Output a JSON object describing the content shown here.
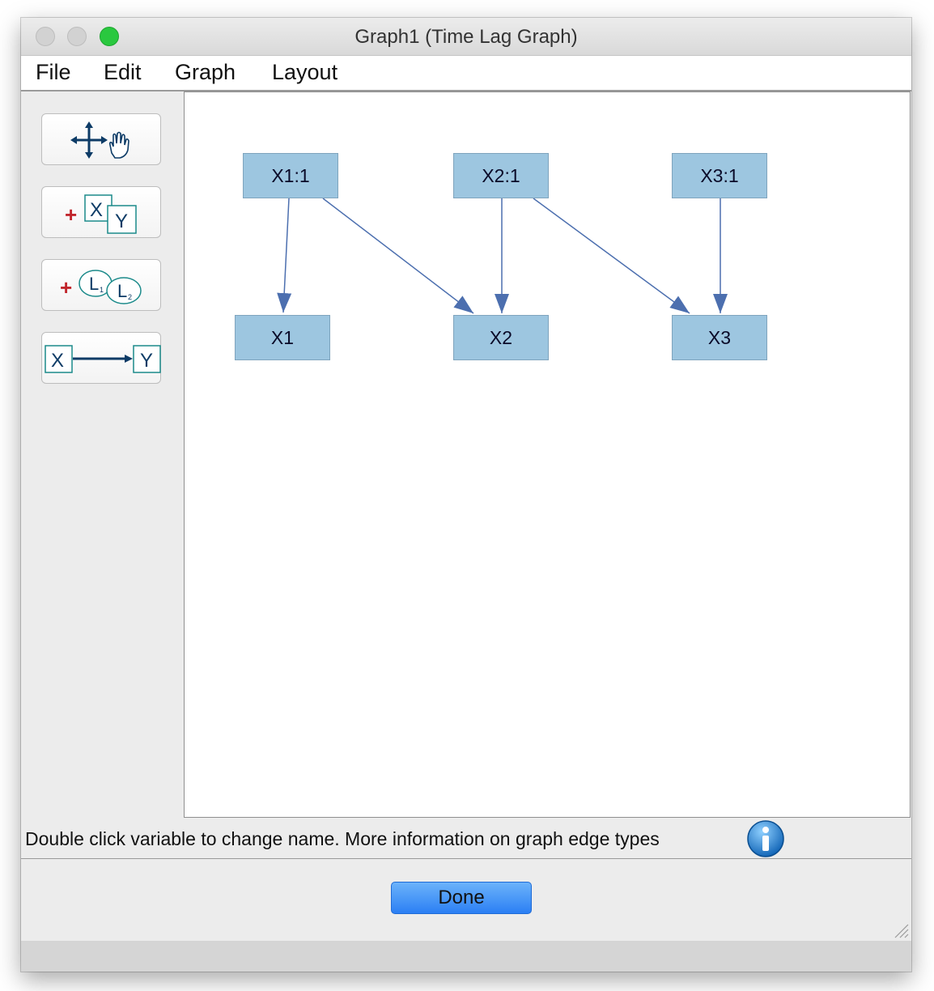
{
  "window": {
    "title": "Graph1 (Time Lag Graph)"
  },
  "menu": {
    "items": [
      "File",
      "Edit",
      "Graph",
      "Layout"
    ]
  },
  "toolbar": {
    "tools": [
      {
        "name": "move",
        "icon": "move-hand-icon"
      },
      {
        "name": "add-variable",
        "icon": "add-measured-variable-icon",
        "glyphs": [
          "+",
          "X",
          "Y"
        ]
      },
      {
        "name": "add-latent",
        "icon": "add-latent-variable-icon",
        "glyphs": [
          "+",
          "L",
          "L"
        ]
      },
      {
        "name": "add-edge",
        "icon": "directed-edge-icon",
        "glyphs": [
          "X",
          "Y"
        ]
      }
    ]
  },
  "graph": {
    "nodes": [
      "X1:1",
      "X2:1",
      "X3:1",
      "X1",
      "X2",
      "X3"
    ],
    "edges": [
      [
        "X1:1",
        "X1"
      ],
      [
        "X1:1",
        "X2"
      ],
      [
        "X2:1",
        "X2"
      ],
      [
        "X2:1",
        "X3"
      ],
      [
        "X3:1",
        "X3"
      ]
    ],
    "node_color": "#9dc6e0",
    "edge_color": "#4c6faf"
  },
  "status": {
    "text": "Double click variable to change name. More information on graph edge types",
    "icon": "info-icon"
  },
  "buttons": {
    "done": "Done"
  },
  "colors": {
    "primary_button": "#2b7ff4",
    "window_bg": "#ececec"
  }
}
